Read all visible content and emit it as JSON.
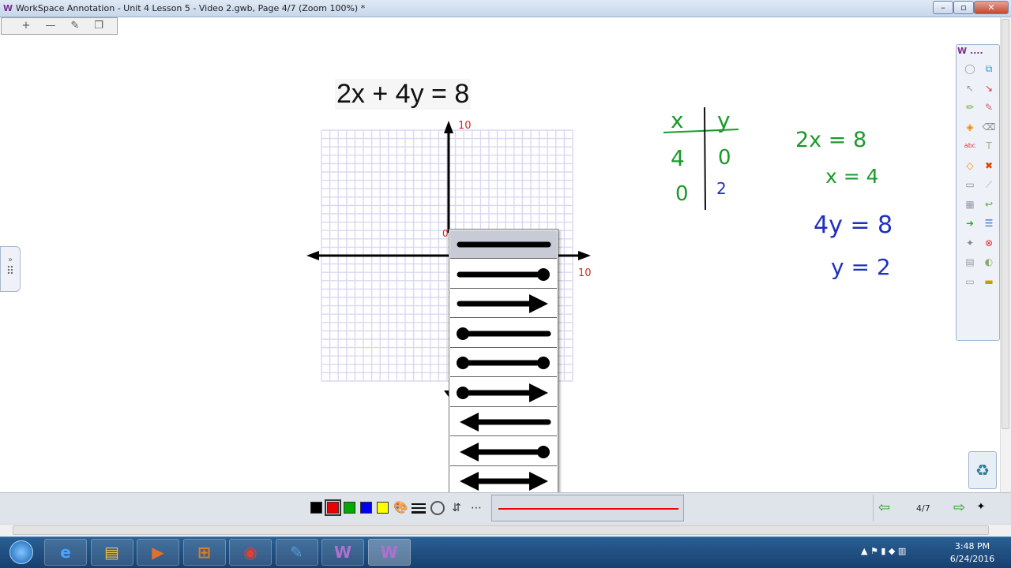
{
  "window": {
    "title": "WorkSpace Annotation - Unit 4 Lesson 5 - Video 2.gwb, Page 4/7 (Zoom 100%) *",
    "minimize": "–",
    "maximize": "▫",
    "close": "✕"
  },
  "toolbar_top": {
    "items": [
      {
        "name": "add-page-icon",
        "glyph": "+"
      },
      {
        "name": "delete-page-icon",
        "glyph": "—"
      },
      {
        "name": "edit-page-icon",
        "glyph": "✎"
      },
      {
        "name": "duplicate-page-icon",
        "glyph": "❐"
      }
    ]
  },
  "canvas": {
    "equation": "2x + 4y = 8",
    "graph": {
      "y_axis_label": "10",
      "x_axis_label": "10",
      "origin_mark": "0"
    },
    "table": {
      "headers": [
        "x",
        "y"
      ],
      "rows": [
        [
          "4",
          "0"
        ],
        [
          "0",
          "2"
        ]
      ]
    },
    "work": {
      "green_line1": "2x = 8",
      "green_line2": "x = 4",
      "blue_line1": "4y = 8",
      "blue_line2": "y = 2"
    }
  },
  "palette": {
    "title": "W ....",
    "icons": [
      "pointer-icon",
      "select-icon",
      "arrow-icon",
      "laser-pointer-icon",
      "pen-icon",
      "highlighter-icon",
      "fill-icon",
      "eraser-icon",
      "text-icon",
      "text-format-icon",
      "shape-icon",
      "delete-icon",
      "page-icon",
      "line-tool-icon",
      "table-icon",
      "undo-icon",
      "next-icon",
      "line-style-icon",
      "clear-icon",
      "save-icon",
      "camera-icon",
      "screen-icon",
      "folder-icon",
      "recycle-icon"
    ]
  },
  "side_tab": {
    "glyph_top": "»",
    "glyph_bottom": "⠿"
  },
  "line_dropdown": {
    "options": [
      {
        "name": "plain-line",
        "start": "none",
        "end": "none",
        "selected": true
      },
      {
        "name": "line-dot-end",
        "start": "none",
        "end": "dot"
      },
      {
        "name": "line-arrow-end",
        "start": "none",
        "end": "arrow"
      },
      {
        "name": "line-dot-start",
        "start": "dot",
        "end": "none"
      },
      {
        "name": "line-dot-both",
        "start": "dot",
        "end": "dot"
      },
      {
        "name": "line-dot-start-arrow-end",
        "start": "dot",
        "end": "arrow"
      },
      {
        "name": "line-arrow-start",
        "start": "arrow",
        "end": "none"
      },
      {
        "name": "line-arrow-start-dot-end",
        "start": "arrow",
        "end": "dot"
      },
      {
        "name": "line-arrow-both",
        "start": "arrow",
        "end": "arrow"
      }
    ]
  },
  "bottom_bar": {
    "swatches": [
      "#000000",
      "#ee0000",
      "#00aa00",
      "#0000ee",
      "#ffff00"
    ],
    "selected_swatch": "#ee0000",
    "page_indicator": "4/7",
    "prev_glyph": "⇦",
    "next_glyph": "⇨"
  },
  "taskbar": {
    "apps": [
      "internet-explorer-icon",
      "file-explorer-icon",
      "media-player-icon",
      "app-launcher-icon",
      "chrome-icon",
      "notes-icon",
      "workspace-icon",
      "workspace-active-icon"
    ],
    "time": "3:48 PM",
    "date": "6/24/2016"
  },
  "colors": {
    "grid": "#d8d8f4",
    "axis_label": "#dd2222",
    "green_ink": "#1a9a2a",
    "blue_ink": "#1f2fbf"
  }
}
